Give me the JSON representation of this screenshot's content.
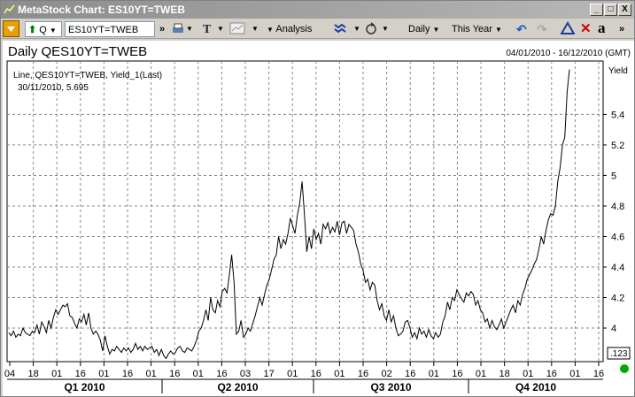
{
  "window": {
    "title": "MetaStock Chart: ES10YT=TWEB",
    "controls": {
      "minimize": "_",
      "maximize": "□",
      "close": "X"
    }
  },
  "toolbar": {
    "security_type": "Q",
    "symbol_value": "ES10YT=TWEB",
    "analysis_label": "Analysis",
    "periodicity_label": "Daily",
    "range_label": "This Year"
  },
  "chart": {
    "title": "Daily QES10YT=TWEB",
    "date_range": "04/01/2010 - 16/12/2010 (GMT)",
    "legend_line1": "Line, QES10YT=TWEB, Yield_1(Last)",
    "legend_line2": "30/11/2010, 5.695",
    "y_axis_title": "Yield",
    "readout": ".123",
    "status_color": "#00aa00"
  },
  "chart_data": {
    "type": "line",
    "series": [
      {
        "name": "QES10YT=TWEB",
        "values": [
          3.97,
          3.95,
          3.98,
          3.94,
          3.96,
          3.95,
          4.0,
          3.97,
          3.96,
          3.95,
          3.98,
          3.97,
          4.02,
          3.96,
          4.04,
          4.01,
          3.97,
          4.05,
          4.0,
          4.07,
          4.12,
          4.09,
          4.12,
          4.15,
          4.14,
          4.16,
          4.08,
          4.07,
          4.03,
          4.0,
          4.06,
          4.04,
          4.09,
          4.02,
          4.1,
          4.0,
          3.96,
          3.98,
          3.96,
          3.92,
          3.85,
          3.95,
          3.88,
          3.83,
          3.86,
          3.85,
          3.88,
          3.86,
          3.84,
          3.87,
          3.85,
          3.87,
          3.84,
          3.86,
          3.9,
          3.86,
          3.88,
          3.85,
          3.88,
          3.86,
          3.87,
          3.88,
          3.84,
          3.86,
          3.82,
          3.86,
          3.82,
          3.8,
          3.83,
          3.85,
          3.83,
          3.84,
          3.87,
          3.88,
          3.85,
          3.84,
          3.87,
          3.86,
          3.85,
          3.88,
          3.92,
          3.98,
          4.0,
          4.05,
          4.12,
          4.05,
          4.2,
          4.12,
          4.1,
          4.18,
          4.14,
          4.24,
          4.26,
          4.23,
          4.35,
          4.48,
          4.3,
          3.96,
          3.98,
          4.05,
          3.94,
          3.96,
          4.0,
          3.98,
          4.03,
          4.08,
          4.14,
          4.2,
          4.15,
          4.22,
          4.28,
          4.32,
          4.38,
          4.45,
          4.48,
          4.6,
          4.52,
          4.58,
          4.55,
          4.62,
          4.72,
          4.67,
          4.62,
          4.74,
          4.82,
          4.96,
          4.75,
          4.5,
          4.6,
          4.52,
          4.65,
          4.58,
          4.62,
          4.55,
          4.68,
          4.65,
          4.69,
          4.62,
          4.66,
          4.63,
          4.7,
          4.61,
          4.69,
          4.7,
          4.62,
          4.68,
          4.66,
          4.64,
          4.55,
          4.5,
          4.42,
          4.38,
          4.3,
          4.32,
          4.25,
          4.3,
          4.28,
          4.18,
          4.12,
          4.16,
          4.08,
          4.05,
          4.12,
          4.04,
          4.08,
          4.0,
          3.95,
          3.96,
          3.98,
          4.04,
          4.05,
          4.0,
          3.94,
          3.97,
          3.93,
          4.0,
          3.96,
          3.98,
          3.94,
          3.99,
          3.95,
          3.93,
          3.97,
          3.94,
          3.96,
          4.04,
          4.08,
          4.17,
          4.12,
          4.2,
          4.18,
          4.25,
          4.22,
          4.19,
          4.17,
          4.23,
          4.21,
          4.24,
          4.22,
          4.15,
          4.18,
          4.12,
          4.1,
          4.04,
          4.06,
          4.0,
          4.05,
          4.01,
          3.99,
          4.02,
          4.06,
          4.0,
          4.04,
          4.08,
          4.12,
          4.15,
          4.1,
          4.18,
          4.15,
          4.22,
          4.26,
          4.32,
          4.35,
          4.38,
          4.42,
          4.45,
          4.52,
          4.6,
          4.55,
          4.64,
          4.71,
          4.75,
          4.74,
          4.8,
          4.96,
          5.05,
          5.2,
          5.25,
          5.55,
          5.695
        ]
      }
    ],
    "y_ticks": [
      4,
      4.2,
      4.4,
      4.6,
      4.8,
      5,
      5.2,
      5.4
    ],
    "x_ticks": [
      "04",
      "18",
      "01",
      "16",
      "01",
      "16",
      "01",
      "16",
      "01",
      "16",
      "03",
      "17",
      "01",
      "16",
      "01",
      "16",
      "02",
      "16",
      "01",
      "16",
      "01",
      "18",
      "01",
      "16",
      "01",
      "16"
    ],
    "quarters": [
      "Q1 2010",
      "Q2 2010",
      "Q3 2010",
      "Q4 2010"
    ],
    "ylim": [
      3.78,
      5.75
    ],
    "grid": true
  }
}
